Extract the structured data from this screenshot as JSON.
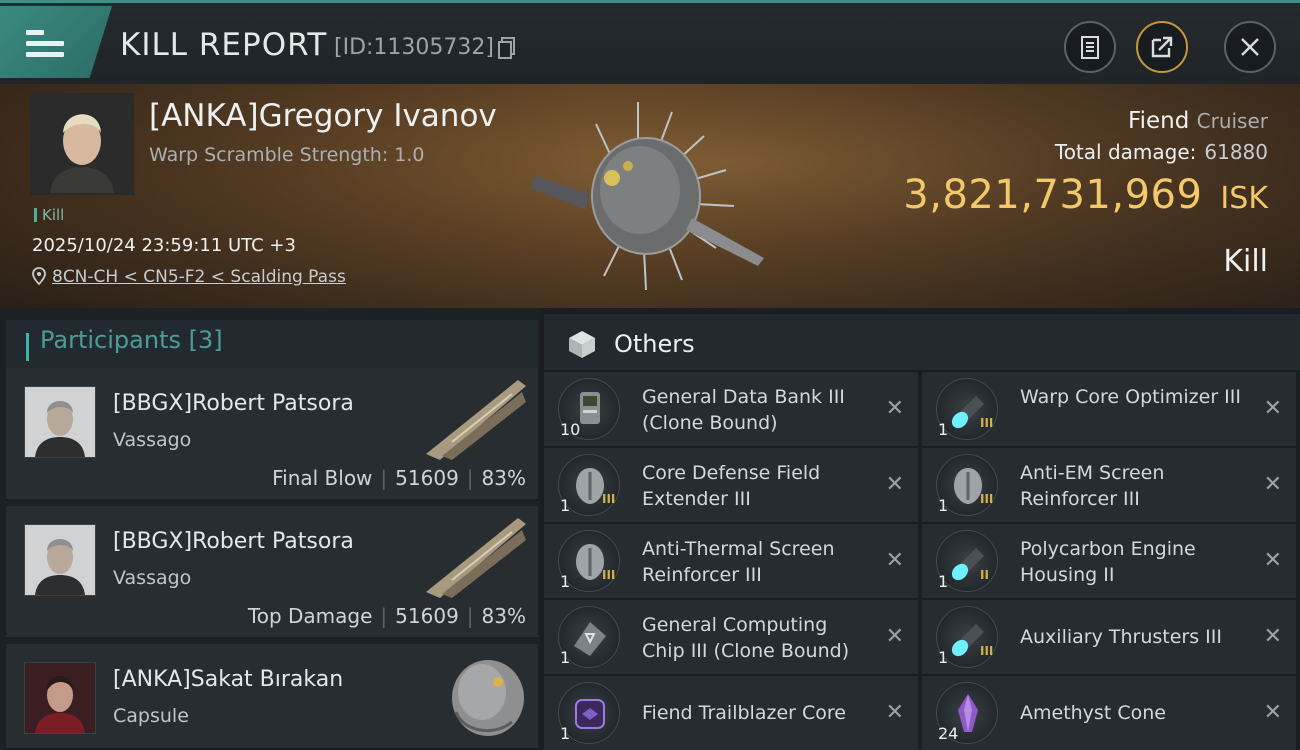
{
  "header": {
    "title": "KILL REPORT",
    "report_id": "[ID:11305732]"
  },
  "victim": {
    "name": "[ANKA]Gregory Ivanov",
    "warp_scramble": "Warp Scramble Strength: 1.0",
    "tag": "Kill",
    "datetime": "2025/10/24 23:59:11 UTC +3",
    "location": "8CN-CH < CN5-F2 < Scalding Pass",
    "ship": "Fiend",
    "ship_class": "Cruiser",
    "damage_label": "Total damage:",
    "damage_value": "61880",
    "isk_amount": "3,821,731,969",
    "isk_unit": "ISK",
    "result": "Kill"
  },
  "participants": {
    "label": "Participants",
    "count": "[3]",
    "items": [
      {
        "name": "[BBGX]Robert Patsora",
        "ship": "Vassago",
        "role": "Final Blow",
        "damage": "51609",
        "percent": "83%"
      },
      {
        "name": "[BBGX]Robert Patsora",
        "ship": "Vassago",
        "role": "Top Damage",
        "damage": "51609",
        "percent": "83%"
      },
      {
        "name": "[ANKA]Sakat Bırakan",
        "ship": "Capsule",
        "role": "",
        "damage": "",
        "percent": ""
      }
    ]
  },
  "others": {
    "label": "Others",
    "items": [
      {
        "name": "General Data Bank III (Clone Bound)",
        "qty": "10",
        "tier": "",
        "icon": "data-bank-icon"
      },
      {
        "name": "Warp Core Optimizer III",
        "qty": "1",
        "tier": "III",
        "icon": "thruster-icon"
      },
      {
        "name": "Core Defense Field Extender III",
        "qty": "1",
        "tier": "III",
        "icon": "shield-module-icon"
      },
      {
        "name": "Anti-EM Screen Reinforcer III",
        "qty": "1",
        "tier": "III",
        "icon": "shield-module-icon"
      },
      {
        "name": "Anti-Thermal Screen Reinforcer III",
        "qty": "1",
        "tier": "III",
        "icon": "shield-module-icon"
      },
      {
        "name": "Polycarbon Engine Housing II",
        "qty": "1",
        "tier": "II",
        "icon": "thruster-icon"
      },
      {
        "name": "General Computing Chip III (Clone Bound)",
        "qty": "1",
        "tier": "",
        "icon": "chip-icon"
      },
      {
        "name": "Auxiliary Thrusters III",
        "qty": "1",
        "tier": "III",
        "icon": "thruster-icon"
      },
      {
        "name": "Fiend Trailblazer Core",
        "qty": "1",
        "tier": "",
        "icon": "core-icon"
      },
      {
        "name": "Amethyst Cone",
        "qty": "24",
        "tier": "",
        "icon": "crystal-icon"
      }
    ]
  },
  "colors": {
    "accent": "#3f8f86",
    "isk": "#f2c86a"
  }
}
